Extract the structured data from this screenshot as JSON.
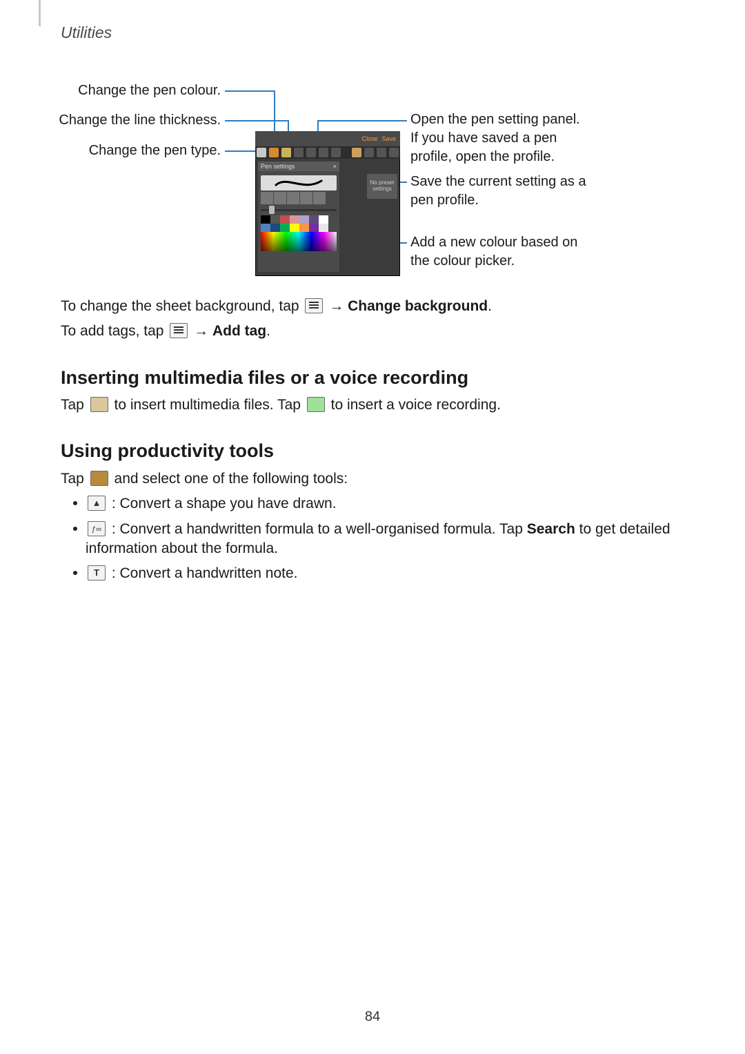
{
  "header": {
    "section": "Utilities"
  },
  "callouts": {
    "colour": "Change the pen colour.",
    "thickness": "Change the line thickness.",
    "pentype": "Change the pen type.",
    "openpanel": "Open the pen setting panel. If you have saved a pen profile, open the profile.",
    "saveprofile": "Save the current setting as a pen profile.",
    "addcolour": "Add a new colour based on the colour picker."
  },
  "shot": {
    "close": "Close",
    "save": "Save",
    "panel_title": "Pen settings",
    "panel_close": "×",
    "preset": "No preset settings"
  },
  "body": {
    "bg1": "To change the sheet background, tap ",
    "bg2": " → ",
    "bg_bold": "Change background",
    "bg3": ".",
    "tag1": "To add tags, tap ",
    "tag2": " → ",
    "tag_bold": "Add tag",
    "tag3": ".",
    "h_insert": "Inserting multimedia files or a voice recording",
    "ins1": "Tap ",
    "ins2": " to insert multimedia files. Tap ",
    "ins3": " to insert a voice recording.",
    "h_tools": "Using productivity tools",
    "tool1a": "Tap ",
    "tool1b": " and select one of the following tools:",
    "b1": " : Convert a shape you have drawn.",
    "b2a": " : Convert a handwritten formula to a well-organised formula. Tap ",
    "b2bold": "Search",
    "b2b": " to get detailed information about the formula.",
    "b3": " : Convert a handwritten note."
  },
  "page": "84"
}
